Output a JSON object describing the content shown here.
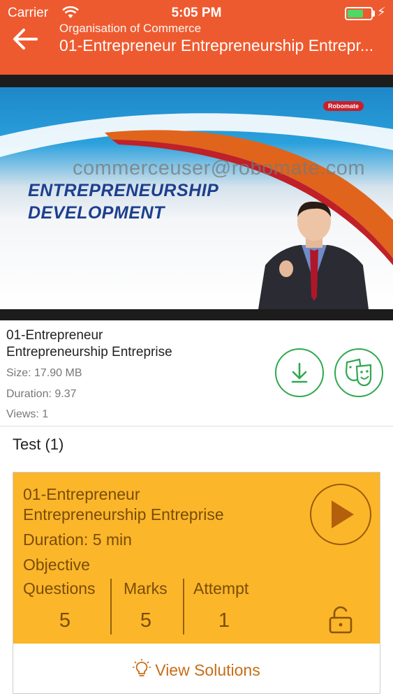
{
  "status_bar": {
    "carrier": "Carrier",
    "time": "5:05 PM",
    "battery_level": 0.7
  },
  "header": {
    "back_icon": "arrow-left-icon",
    "subtitle": "Organisation of Commerce",
    "title": "01-Entrepreneur Entrepreneurship Entrepr..."
  },
  "video": {
    "brand_badge": "Robomate",
    "watermark": "commerceuser@robomate.com",
    "slide_title_line1": "ENTREPRENEURSHIP",
    "slide_title_line2": "DEVELOPMENT"
  },
  "lecture": {
    "title_line1": "01-Entrepreneur",
    "title_line2": "Entrepreneurship Entreprise",
    "size": "Size: 17.90 MB",
    "duration": "Duration: 9.37",
    "views": "Views: 1",
    "download_icon": "download-icon",
    "fun_icon": "fun-mask-icon"
  },
  "test_section": {
    "heading": "Test (1)",
    "card": {
      "name_line1": "01-Entrepreneur",
      "name_line2": "Entrepreneurship Entreprise",
      "duration": "Duration:  5 min",
      "type": "Objective",
      "questions_label": "Questions",
      "questions_value": "5",
      "marks_label": "Marks",
      "marks_value": "5",
      "attempt_label": "Attempt",
      "attempt_value": "1",
      "play_icon": "play-icon",
      "lock_icon": "unlock-icon",
      "view_solutions": "View Solutions",
      "bulb_icon": "lightbulb-icon"
    }
  },
  "colors": {
    "header": "#ee5a2f",
    "card": "#fbb62a",
    "card_text": "#7a4d08",
    "accent_green": "#2fa84f",
    "link_orange": "#c76d17"
  }
}
